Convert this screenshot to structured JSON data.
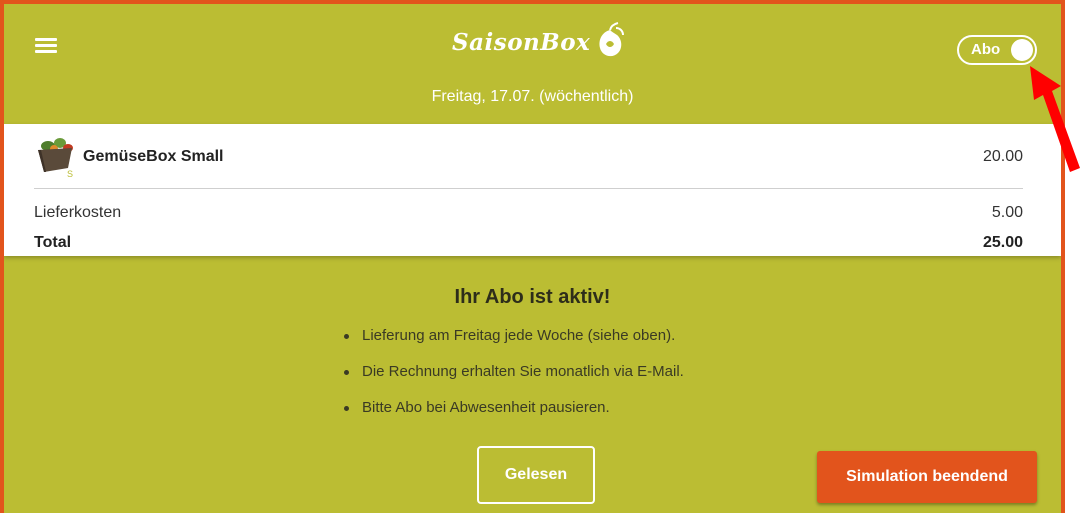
{
  "header": {
    "logo_text": "SaisonBox",
    "subtitle": "Freitag, 17.07. (wöchentlich)",
    "toggle_label": "Abo",
    "toggle_on": true
  },
  "order": {
    "product_name": "GemüseBox Small",
    "product_badge": "S",
    "product_price": "20.00",
    "delivery_label": "Lieferkosten",
    "delivery_value": "5.00",
    "total_label": "Total",
    "total_value": "25.00"
  },
  "info": {
    "heading": "Ihr Abo ist aktiv!",
    "bullets": [
      "Lieferung am Freitag jede Woche (siehe oben).",
      "Die Rechnung erhalten Sie monatlich via E-Mail.",
      "Bitte Abo bei Abwesenheit pausieren."
    ]
  },
  "buttons": {
    "read": "Gelesen",
    "end_simulation": "Simulation beendend"
  },
  "colors": {
    "brand_green": "#bbbd33",
    "accent_orange": "#e2541c",
    "annotation_red": "#ff0000"
  },
  "icons": [
    "menu-icon",
    "pear-logo-icon",
    "vegetable-box-icon",
    "annotation-arrow"
  ]
}
